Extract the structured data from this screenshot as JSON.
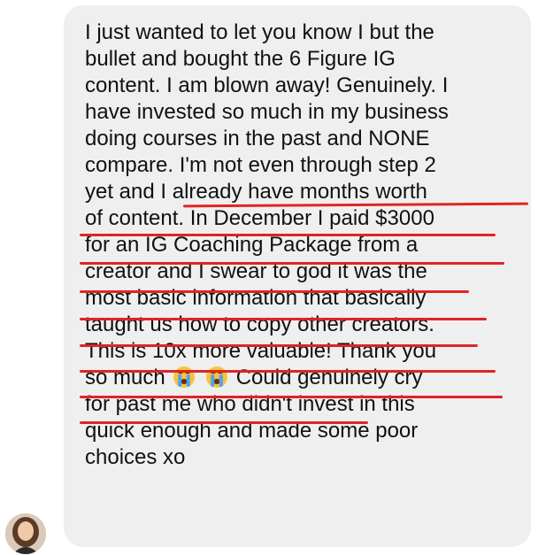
{
  "message": {
    "lines": [
      "I just wanted to let you know I but the",
      "bullet and bought the 6 Figure IG",
      "content. I am blown away! Genuinely. I",
      "have invested so much in my business",
      "doing courses in the past and NONE",
      "compare. I'm not even through step 2",
      "yet and I already have months worth",
      "of content. In December I paid $3000",
      "for an IG Coaching Package from a",
      "creator and I swear to god it was the",
      "most basic information that basically",
      "taught us how to copy other creators.",
      "This is 10x more valuable! Thank you",
      "so much",
      "Could genuinely cry",
      "for past me who didn't invest in this",
      "quick enough and made some poor",
      "choices xo"
    ],
    "emoji": [
      "loudly-crying-face-emoji",
      "loudly-crying-face-emoji"
    ]
  },
  "colors": {
    "bubble": "#efeff0",
    "text": "#111111",
    "underline": "#e02424"
  },
  "avatar": {
    "icon": "user-avatar"
  }
}
